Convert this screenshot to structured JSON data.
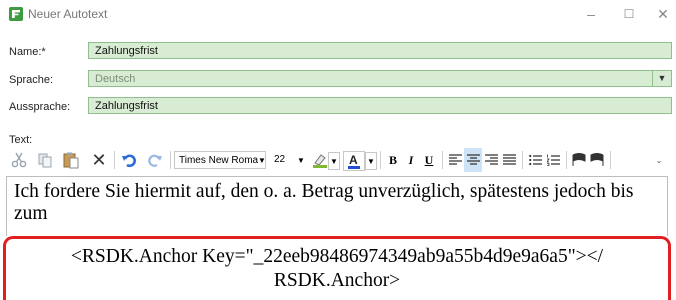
{
  "window": {
    "title": "Neuer Autotext",
    "minimize": "–",
    "maximize": "☐",
    "close": "✕"
  },
  "form": {
    "name": {
      "label": "Name:*",
      "value": "Zahlungsfrist"
    },
    "sprache": {
      "label": "Sprache:",
      "value": "Deutsch"
    },
    "aussprache": {
      "label": "Aussprache:",
      "value": "Zahlungsfrist"
    },
    "text_label": "Text:"
  },
  "toolbar": {
    "font_name": "Times New Roma",
    "font_size": "22",
    "bold": "B",
    "italic": "I",
    "underline": "U",
    "icons": [
      "cut-icon",
      "copy-icon",
      "paste-icon",
      "delete-icon",
      "undo-icon",
      "redo-icon",
      "highlight-color-icon",
      "font-color-icon",
      "align-left-icon",
      "align-center-icon",
      "align-right-icon",
      "justify-icon",
      "bullet-list-icon",
      "numbered-list-icon",
      "flag-icon",
      "flag-icon"
    ]
  },
  "editor": {
    "line1": "Ich fordere Sie hiermit auf, den o. a. Betrag unverzüglich, spätestens jedoch bis",
    "line2": "zum"
  },
  "anchor": {
    "line1": "<RSDK.Anchor Key=\"_22eeb98486974349ab9a55b4d9e9a6a5\"></",
    "line2": "RSDK.Anchor>"
  },
  "colors": {
    "field_bg": "#d8ecd4",
    "field_border": "#8fbf8f",
    "highlight_border": "#e02020",
    "app_icon": "#3f9b3f"
  }
}
